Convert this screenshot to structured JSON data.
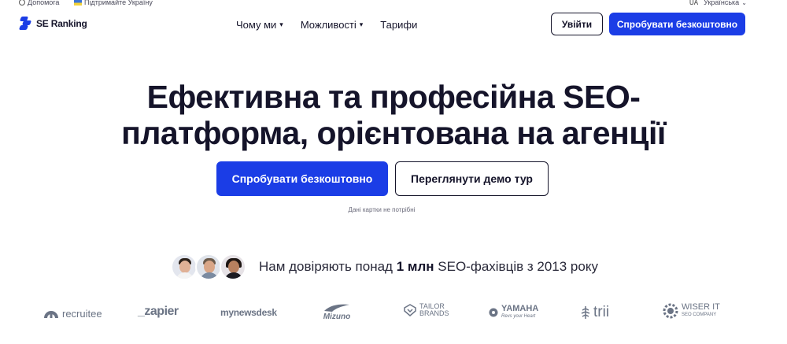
{
  "utility_bar": {
    "help": "Допомога",
    "support_ukraine": "Підтримайте Україну",
    "lang_code": "UA",
    "lang_label": "Українська"
  },
  "header": {
    "logo_text": "SE Ranking",
    "nav": [
      "Чому ми",
      "Можливості",
      "Тарифи"
    ],
    "login_label": "Увійти",
    "try_label": "Спробувати безкоштовно"
  },
  "hero": {
    "title_line1": "Ефективна та професійна SEO-",
    "title_line2": "платформа, орієнтована на агенції",
    "primary_cta": "Спробувати безкоштовно",
    "secondary_cta": "Переглянути демо тур",
    "note": "Дані картки не потрібні"
  },
  "trust": {
    "prefix": "Нам довіряють понад",
    "bold": "1 млн",
    "suffix": "SEO-фахівців з 2013 року"
  },
  "brands": {
    "recruitee": "recruitee",
    "zapier": "_zapier",
    "mynewsdesk": "mynewsdesk",
    "mizuno": "Mizuno",
    "tailor_1": "TAILOR",
    "tailor_2": "BRANDS",
    "yamaha": "YAMAHA",
    "yamaha_tag": "Revs your Heart",
    "trii": "trii",
    "wiser_1": "WISER IT",
    "wiser_2": "SEO COMPANY"
  },
  "colors": {
    "brand_blue": "#1b3de6",
    "text_dark": "#15142a",
    "logo_gray": "#6b7485"
  }
}
